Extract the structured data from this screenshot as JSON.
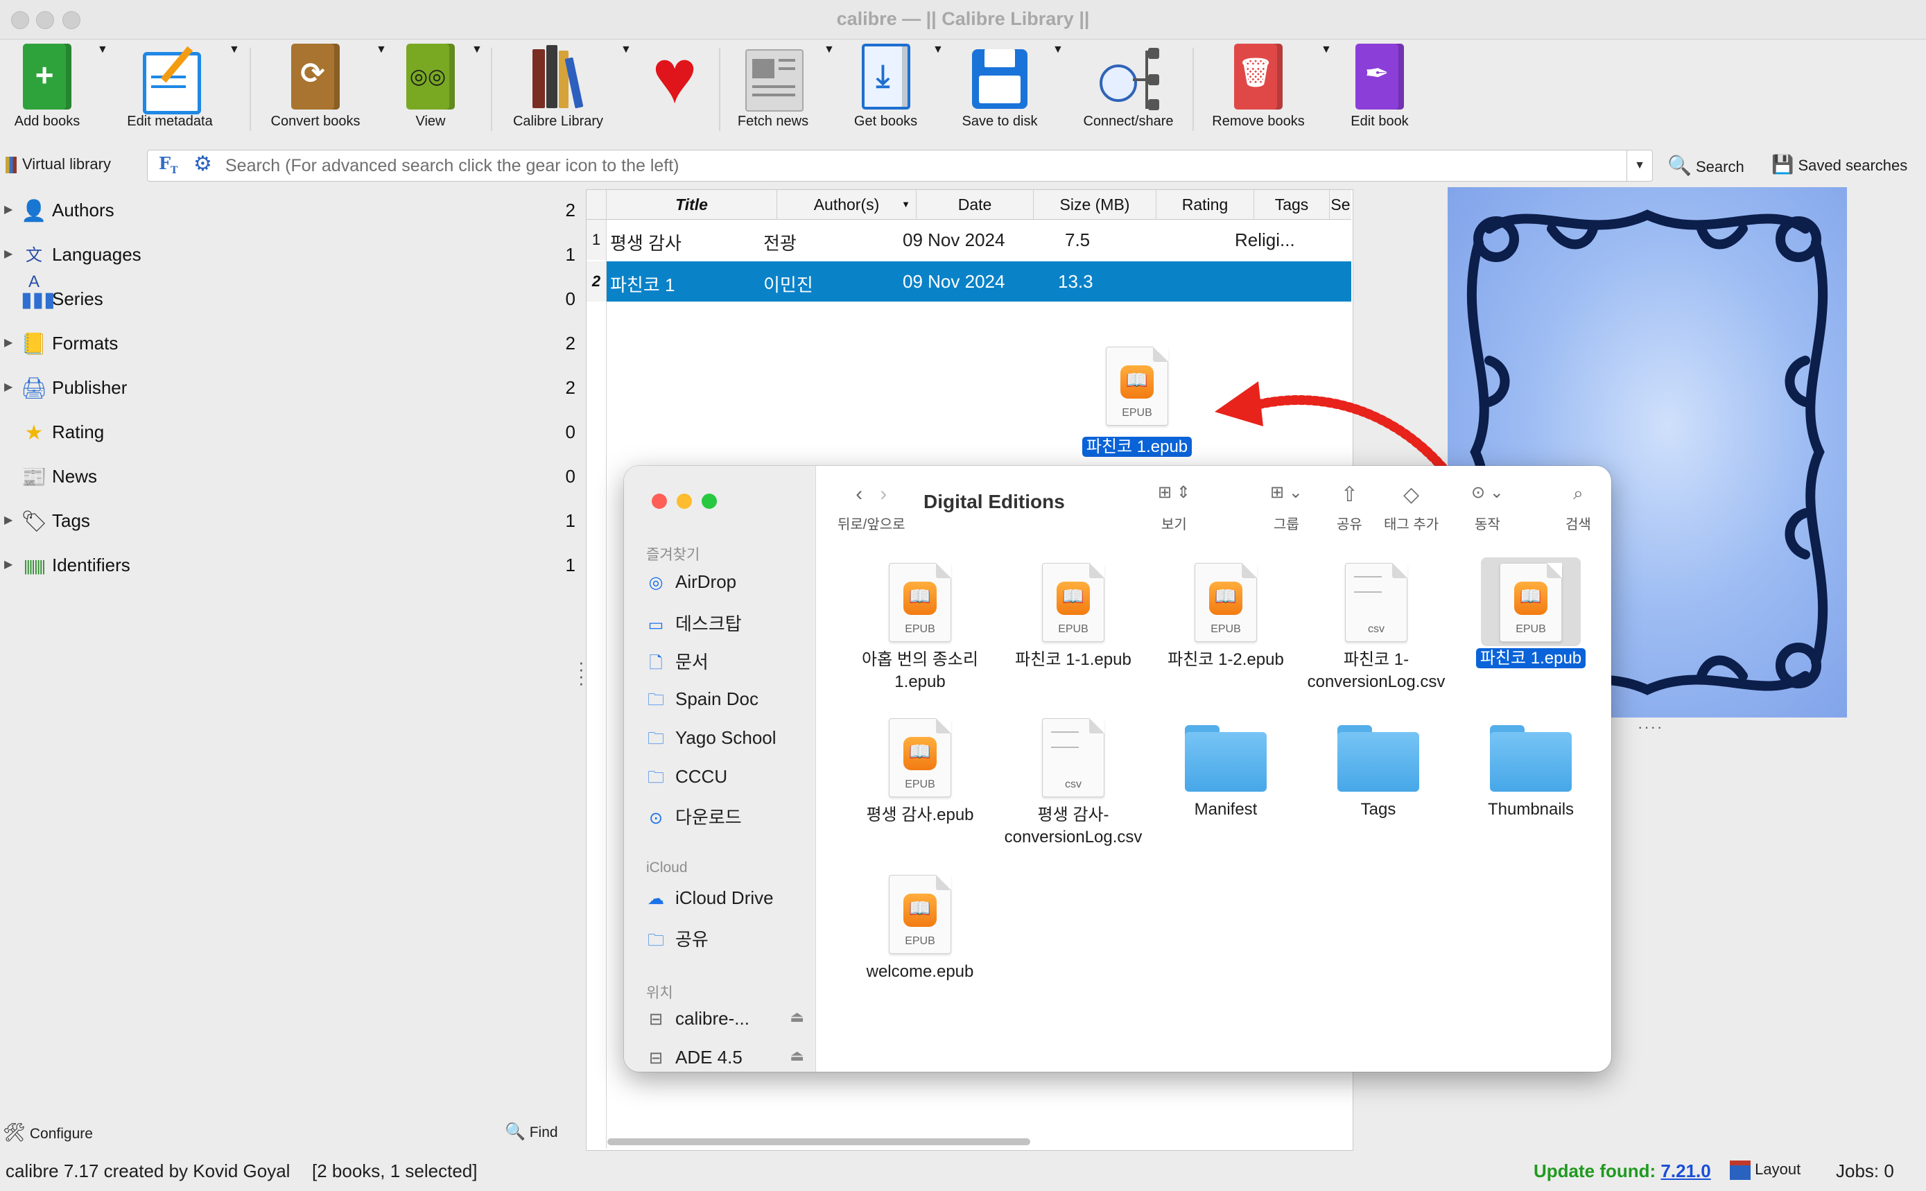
{
  "window": {
    "title": "calibre — || Calibre Library ||"
  },
  "toolbar": [
    {
      "id": "add",
      "label": "Add books",
      "icon": "add-book-icon",
      "color": "#2fa33b",
      "has_menu": true
    },
    {
      "id": "edit_meta",
      "label": "Edit metadata",
      "icon": "edit-metadata-icon",
      "color": "#1e88e5",
      "has_menu": true
    },
    {
      "id": "convert",
      "label": "Convert books",
      "icon": "convert-book-icon",
      "color": "#9a6a2c",
      "has_menu": true
    },
    {
      "id": "view",
      "label": "View",
      "icon": "view-book-icon",
      "color": "#6c9a1e",
      "has_menu": true
    },
    {
      "id": "library",
      "label": "Calibre Library",
      "icon": "library-books-icon",
      "color": "#8b3a2a",
      "has_menu": true
    },
    {
      "id": "donate",
      "label": "",
      "icon": "heart-icon",
      "color": "#e0141b",
      "has_menu": false
    },
    {
      "id": "fetch",
      "label": "Fetch news",
      "icon": "newspaper-icon",
      "color": "#9e9e9e",
      "has_menu": true
    },
    {
      "id": "get",
      "label": "Get books",
      "icon": "download-book-icon",
      "color": "#1e6fd0",
      "has_menu": true
    },
    {
      "id": "save",
      "label": "Save to disk",
      "icon": "floppy-disk-icon",
      "color": "#1a73d9",
      "has_menu": true
    },
    {
      "id": "connect",
      "label": "Connect/share",
      "icon": "network-globe-icon",
      "color": "#3a4a66",
      "has_menu": false
    },
    {
      "id": "remove",
      "label": "Remove books",
      "icon": "trash-book-icon",
      "color": "#e04848",
      "has_menu": true
    },
    {
      "id": "editbook",
      "label": "Edit book",
      "icon": "quill-book-icon",
      "color": "#8c3ed8",
      "has_menu": false
    }
  ],
  "search": {
    "virtual_library": "Virtual library",
    "placeholder": "Search (For advanced search click the gear icon to the left)",
    "search_label": "Search",
    "saved_searches": "Saved searches"
  },
  "tag_browser": [
    {
      "name": "Authors",
      "count": "2",
      "icon": "person-icon",
      "expandable": true
    },
    {
      "name": "Languages",
      "count": "1",
      "icon": "language-icon",
      "expandable": true
    },
    {
      "name": "Series",
      "count": "0",
      "icon": "series-icon",
      "expandable": false
    },
    {
      "name": "Formats",
      "count": "2",
      "icon": "formats-icon",
      "expandable": true
    },
    {
      "name": "Publisher",
      "count": "2",
      "icon": "publisher-icon",
      "expandable": true
    },
    {
      "name": "Rating",
      "count": "0",
      "icon": "star-icon",
      "expandable": false
    },
    {
      "name": "News",
      "count": "0",
      "icon": "news-icon",
      "expandable": false
    },
    {
      "name": "Tags",
      "count": "1",
      "icon": "tag-icon",
      "expandable": true
    },
    {
      "name": "Identifiers",
      "count": "1",
      "icon": "barcode-icon",
      "expandable": true
    }
  ],
  "table": {
    "columns": [
      "Title",
      "Author(s)",
      "Date",
      "Size (MB)",
      "Rating",
      "Tags",
      "Se"
    ],
    "rows": [
      {
        "num": "1",
        "title": "평생 감사",
        "author": "전광",
        "date": "09 Nov 2024",
        "size": "7.5",
        "rating": "",
        "tags": "Religi...",
        "selected": false
      },
      {
        "num": "2",
        "title": "파친코 1",
        "author": "이민진",
        "date": "09 Nov 2024",
        "size": "13.3",
        "rating": "",
        "tags": "",
        "selected": true
      }
    ]
  },
  "drag_file": {
    "name": "파친코 1.epub",
    "type_label": "EPUB"
  },
  "finder": {
    "title": "Digital Editions",
    "toolbar": {
      "back_forward": "뒤로/앞으로",
      "view": "보기",
      "group": "그룹",
      "share": "공유",
      "add_tag": "태그 추가",
      "action": "동작",
      "search": "검색"
    },
    "sidebar": {
      "favorites_header": "즐겨찾기",
      "favorites": [
        {
          "label": "AirDrop",
          "icon": "airdrop-icon"
        },
        {
          "label": "데스크탑",
          "icon": "desktop-icon"
        },
        {
          "label": "문서",
          "icon": "document-icon"
        },
        {
          "label": "Spain Doc",
          "icon": "folder-icon"
        },
        {
          "label": "Yago School",
          "icon": "folder-icon"
        },
        {
          "label": "CCCU",
          "icon": "folder-icon"
        },
        {
          "label": "다운로드",
          "icon": "download-icon"
        }
      ],
      "icloud_header": "iCloud",
      "icloud": [
        {
          "label": "iCloud Drive",
          "icon": "cloud-icon"
        },
        {
          "label": "공유",
          "icon": "shared-folder-icon"
        }
      ],
      "locations_header": "위치",
      "locations": [
        {
          "label": "calibre-...",
          "icon": "drive-icon"
        },
        {
          "label": "ADE 4.5",
          "icon": "drive-icon"
        }
      ]
    },
    "files": [
      {
        "name": "아홉 번의 종소리 1.epub",
        "kind": "epub",
        "type_label": "EPUB",
        "selected": false
      },
      {
        "name": "파친코 1-1.epub",
        "kind": "epub",
        "type_label": "EPUB",
        "selected": false
      },
      {
        "name": "파친코 1-2.epub",
        "kind": "epub",
        "type_label": "EPUB",
        "selected": false
      },
      {
        "name": "파친코 1-conversionLog.csv",
        "kind": "csv",
        "type_label": "csv",
        "selected": false
      },
      {
        "name": "파친코 1.epub",
        "kind": "epub",
        "type_label": "EPUB",
        "selected": true
      },
      {
        "name": "평생 감사.epub",
        "kind": "epub",
        "type_label": "EPUB",
        "selected": false
      },
      {
        "name": "평생 감사-conversionLog.csv",
        "kind": "csv",
        "type_label": "csv",
        "selected": false
      },
      {
        "name": "Manifest",
        "kind": "folder",
        "type_label": "",
        "selected": false
      },
      {
        "name": "Tags",
        "kind": "folder",
        "type_label": "",
        "selected": false
      },
      {
        "name": "Thumbnails",
        "kind": "folder",
        "type_label": "",
        "selected": false
      },
      {
        "name": "welcome.epub",
        "kind": "epub",
        "type_label": "EPUB",
        "selected": false
      }
    ]
  },
  "bottom_buttons": {
    "configure": "Configure",
    "find": "Find"
  },
  "status": {
    "left": "calibre 7.17 created by Kovid Goyal",
    "books": "[2 books, 1 selected]",
    "update_prefix": "Update found:",
    "update_version": "7.21.0",
    "layout": "Layout",
    "jobs": "Jobs: 0"
  },
  "colors": {
    "accent_blue": "#0a82c8",
    "finder_select": "#0a63d8",
    "update_green": "#1f9a1f",
    "annotation_red": "#e8231b"
  }
}
